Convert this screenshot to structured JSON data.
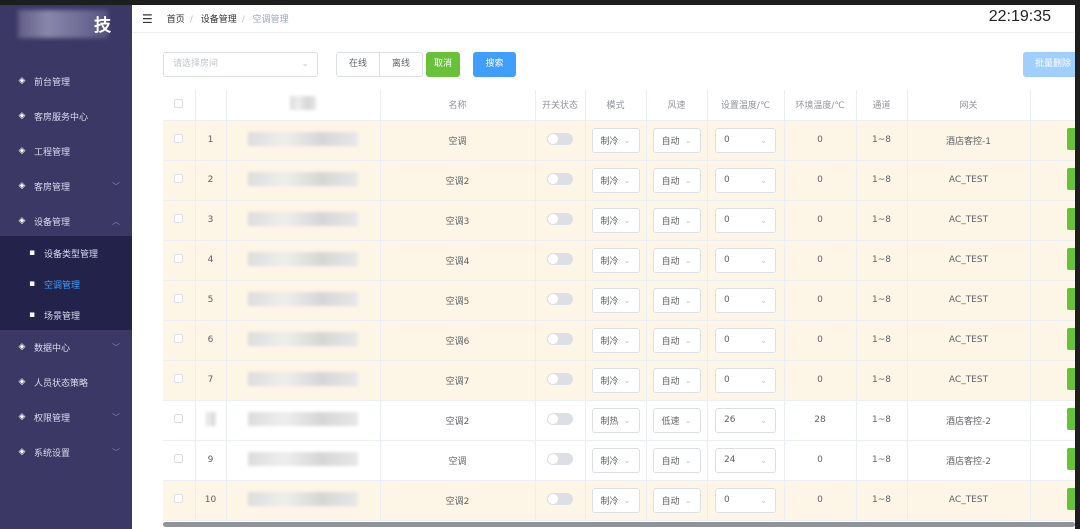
{
  "sidebar": {
    "logo_char": "技",
    "items": [
      {
        "label": "前台管理",
        "icon": "desk-icon"
      },
      {
        "label": "客房服务中心",
        "icon": "service-icon"
      },
      {
        "label": "工程管理",
        "icon": "engineering-icon"
      },
      {
        "label": "客房管理",
        "icon": "room-icon",
        "arrow": "down"
      },
      {
        "label": "设备管理",
        "icon": "device-icon",
        "arrow": "up"
      }
    ],
    "sub_items": [
      {
        "label": "设备类型管理"
      },
      {
        "label": "空调管理",
        "active": true
      },
      {
        "label": "场景管理"
      }
    ],
    "items_after": [
      {
        "label": "数据中心",
        "arrow": "down"
      },
      {
        "label": "人员状态策略"
      },
      {
        "label": "权限管理",
        "arrow": "down"
      },
      {
        "label": "系统设置",
        "arrow": "down"
      }
    ],
    "active_color": "#409eff"
  },
  "header": {
    "breadcrumb": [
      "首页",
      "设备管理",
      "空调管理"
    ],
    "clock": "22:19:35"
  },
  "toolbar": {
    "room_placeholder": "请选择房间",
    "online": "在线",
    "offline": "离线",
    "cancel": "取消",
    "search": "搜索",
    "batch_delete": "批量删除"
  },
  "table": {
    "columns": [
      "",
      "",
      "名称",
      "开关状态",
      "模式",
      "风速",
      "设置温度/℃",
      "环境温度/℃",
      "通道",
      "网关"
    ],
    "rows": [
      {
        "index": "1",
        "name": "空调",
        "mode": "制冷",
        "speed": "自动",
        "set_temp": "0",
        "env_temp": "0",
        "channel": "1~8",
        "gateway": "酒店客控-1",
        "switch": false
      },
      {
        "index": "2",
        "name": "空调2",
        "mode": "制冷",
        "speed": "自动",
        "set_temp": "0",
        "env_temp": "0",
        "channel": "1~8",
        "gateway": "AC_TEST",
        "switch": false
      },
      {
        "index": "3",
        "name": "空调3",
        "mode": "制冷",
        "speed": "自动",
        "set_temp": "0",
        "env_temp": "0",
        "channel": "1~8",
        "gateway": "AC_TEST",
        "switch": false
      },
      {
        "index": "4",
        "name": "空调4",
        "mode": "制冷",
        "speed": "自动",
        "set_temp": "0",
        "env_temp": "0",
        "channel": "1~8",
        "gateway": "AC_TEST",
        "switch": false
      },
      {
        "index": "5",
        "name": "空调5",
        "mode": "制冷",
        "speed": "自动",
        "set_temp": "0",
        "env_temp": "0",
        "channel": "1~8",
        "gateway": "AC_TEST",
        "switch": false
      },
      {
        "index": "6",
        "name": "空调6",
        "mode": "制冷",
        "speed": "自动",
        "set_temp": "0",
        "env_temp": "0",
        "channel": "1~8",
        "gateway": "AC_TEST",
        "switch": false
      },
      {
        "index": "7",
        "name": "空调7",
        "mode": "制冷",
        "speed": "自动",
        "set_temp": "0",
        "env_temp": "0",
        "channel": "1~8",
        "gateway": "AC_TEST",
        "switch": false
      },
      {
        "index": "",
        "name": "空调2",
        "mode": "制热",
        "speed": "低速",
        "set_temp": "26",
        "env_temp": "28",
        "channel": "1~8",
        "gateway": "酒店客控-2",
        "switch": false
      },
      {
        "index": "9",
        "name": "空调",
        "mode": "制冷",
        "speed": "自动",
        "set_temp": "24",
        "env_temp": "0",
        "channel": "1~8",
        "gateway": "酒店客控-2",
        "switch": false
      },
      {
        "index": "10",
        "name": "空调2",
        "mode": "制冷",
        "speed": "自动",
        "set_temp": "0",
        "env_temp": "0",
        "channel": "1~8",
        "gateway": "AC_TEST",
        "switch": false
      }
    ]
  }
}
